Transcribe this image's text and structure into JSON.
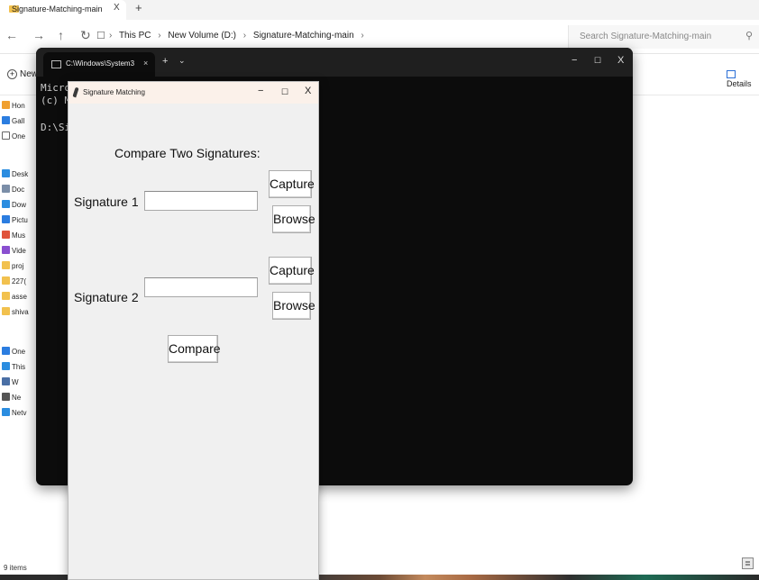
{
  "explorer": {
    "tab_title": "Signature-Matching-main",
    "tab_close": "X",
    "new_tab": "+",
    "nav": {
      "back": "←",
      "forward": "→",
      "up": "↑",
      "refresh": "↻",
      "pc": "☐"
    },
    "breadcrumb": [
      "This PC",
      "New Volume (D:)",
      "Signature-Matching-main"
    ],
    "breadcrumb_sep": "›",
    "search_placeholder": "Search Signature-Matching-main",
    "search_icon": "⚲",
    "new_label": "New",
    "new_icon": "+",
    "details_label": "Details",
    "sidebar": [
      {
        "label": "Hon",
        "icon": "home-icon",
        "color": "#f0a030"
      },
      {
        "label": "Gall",
        "icon": "gallery-icon",
        "color": "#2b7de0"
      },
      {
        "label": "One",
        "icon": "file-icon",
        "color": "#ffffff"
      },
      {
        "label": "Desk",
        "icon": "desktop-icon",
        "color": "#2b8de0"
      },
      {
        "label": "Doc",
        "icon": "document-icon",
        "color": "#7b8ea8"
      },
      {
        "label": "Dow",
        "icon": "download-icon",
        "color": "#2b8de0"
      },
      {
        "label": "Pictu",
        "icon": "pictures-icon",
        "color": "#2b7de0"
      },
      {
        "label": "Mus",
        "icon": "music-icon",
        "color": "#e0533a"
      },
      {
        "label": "Vide",
        "icon": "videos-icon",
        "color": "#8a4fd0"
      },
      {
        "label": "proj",
        "icon": "folder-icon",
        "color": "#f2c14e"
      },
      {
        "label": "227(",
        "icon": "folder-icon",
        "color": "#f2c14e"
      },
      {
        "label": "asse",
        "icon": "folder-icon",
        "color": "#f2c14e"
      },
      {
        "label": "shiva",
        "icon": "folder-icon",
        "color": "#f2c14e"
      },
      {
        "label": "One",
        "icon": "onedrive-icon",
        "color": "#2b7de0"
      },
      {
        "label": "This",
        "icon": "pc-icon",
        "color": "#2b8de0"
      },
      {
        "label": "W",
        "icon": "drive-icon",
        "color": "#4a6fa5"
      },
      {
        "label": "Ne",
        "icon": "drive-icon",
        "color": "#555555"
      },
      {
        "label": "Netv",
        "icon": "network-icon",
        "color": "#2b8de0"
      }
    ],
    "status": "9 items",
    "view_icon": "≣"
  },
  "terminal": {
    "tab_title": "C:\\Windows\\System32\\cmd.exe",
    "tab_close": "×",
    "new_tab": "+",
    "dropdown": "⌄",
    "minimize": "−",
    "maximize": "☐",
    "close": "X",
    "lines": [
      "Microsoft Windows",
      "(c) Microsoft Corporation",
      "",
      "D:\\Signature-Matching-main>"
    ]
  },
  "dialog": {
    "title": "Signature Matching",
    "minimize": "−",
    "maximize": "☐",
    "close": "X",
    "heading": "Compare Two Signatures:",
    "signature1_label": "Signature 1",
    "signature2_label": "Signature 2",
    "signature1_value": "",
    "signature2_value": "",
    "capture_label": "Capture",
    "browse_label": "Browse",
    "compare_label": "Compare"
  }
}
